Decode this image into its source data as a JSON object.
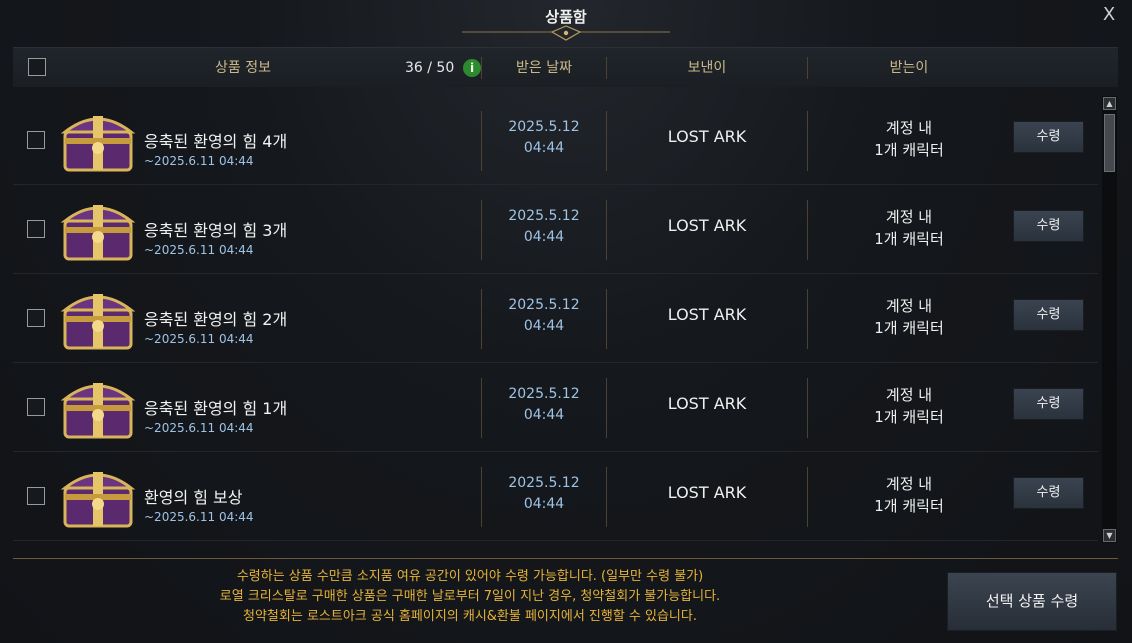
{
  "window": {
    "title": "상품함"
  },
  "header": {
    "product_info": "상품 정보",
    "count": "36 / 50",
    "info_icon_glyph": "i",
    "received_date": "받은 날짜",
    "sender": "보낸이",
    "recipient": "받는이"
  },
  "items": [
    {
      "name": "응축된 환영의 힘 4개",
      "expire": "~2025.6.11  04:44",
      "date": "2025.5.12",
      "time": "04:44",
      "sender": "LOST ARK",
      "recipient_line1": "계정 내",
      "recipient_line2": "1개 캐릭터",
      "claim_label": "수령"
    },
    {
      "name": "응축된 환영의 힘 3개",
      "expire": "~2025.6.11  04:44",
      "date": "2025.5.12",
      "time": "04:44",
      "sender": "LOST ARK",
      "recipient_line1": "계정 내",
      "recipient_line2": "1개 캐릭터",
      "claim_label": "수령"
    },
    {
      "name": "응축된 환영의 힘 2개",
      "expire": "~2025.6.11  04:44",
      "date": "2025.5.12",
      "time": "04:44",
      "sender": "LOST ARK",
      "recipient_line1": "계정 내",
      "recipient_line2": "1개 캐릭터",
      "claim_label": "수령"
    },
    {
      "name": "응축된 환영의 힘 1개",
      "expire": "~2025.6.11  04:44",
      "date": "2025.5.12",
      "time": "04:44",
      "sender": "LOST ARK",
      "recipient_line1": "계정 내",
      "recipient_line2": "1개 캐릭터",
      "claim_label": "수령"
    },
    {
      "name": "환영의 힘 보상",
      "expire": "~2025.6.11  04:44",
      "date": "2025.5.12",
      "time": "04:44",
      "sender": "LOST ARK",
      "recipient_line1": "계정 내",
      "recipient_line2": "1개 캐릭터",
      "claim_label": "수령"
    }
  ],
  "footer": {
    "notice_line1": "수령하는 상품 수만큼 소지품 여유 공간이 있어야 수령 가능합니다. (일부만 수령 불가)",
    "notice_line2": "로열 크리스탈로 구매한 상품은 구매한 날로부터 7일이 지난 경우, 청약철회가 불가능합니다.",
    "notice_line3": "청약철회는 로스트아크 공식 홈페이지의 캐시&환불 페이지에서 진행할 수 있습니다.",
    "claim_selected_label": "선택 상품 수령"
  },
  "icons": {
    "close": "close-icon",
    "info": "info-icon",
    "item": "treasure-chest-icon"
  },
  "colors": {
    "accent_gold": "#c9b98a",
    "date_blue": "#9fc3e6",
    "notice_yellow": "#e6b33a",
    "info_green": "#2e8a2e"
  }
}
